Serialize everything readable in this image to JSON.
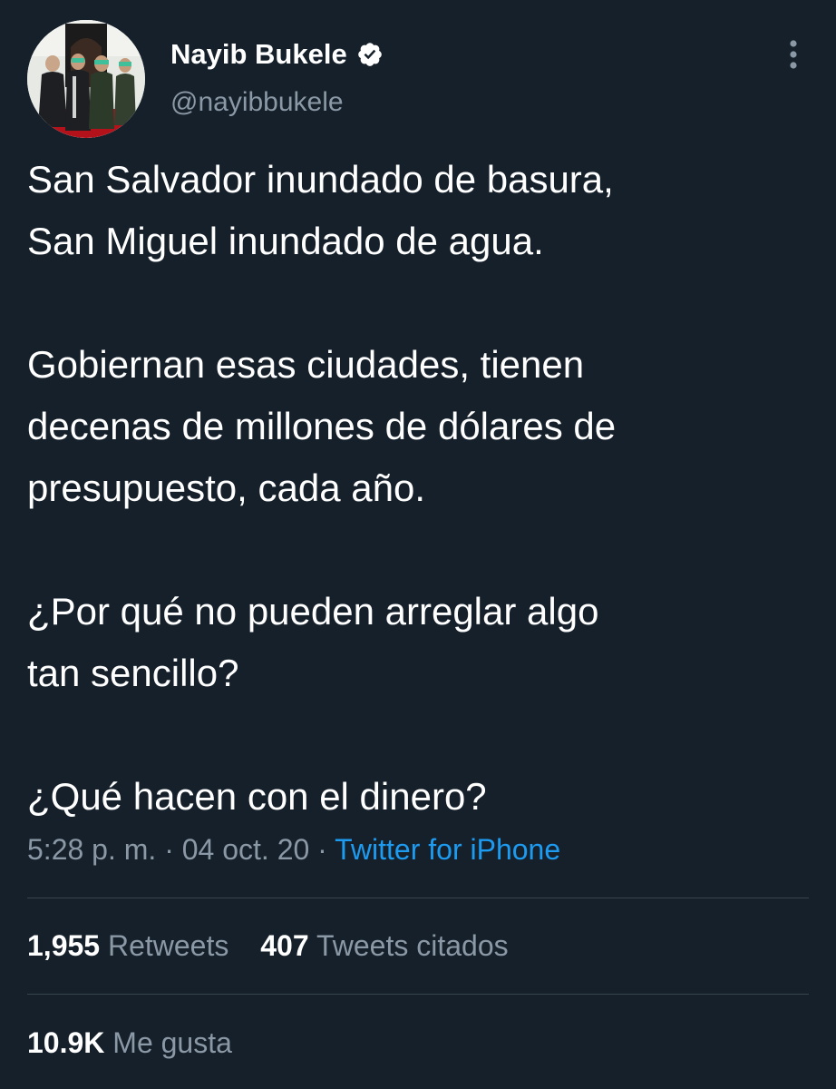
{
  "author": {
    "name": "Nayib Bukele",
    "handle": "@nayibbukele",
    "verified": true,
    "avatar_icon": "profile-photo"
  },
  "tweet": {
    "paragraphs": [
      [
        "San Salvador inundado de basura,",
        "San Miguel inundado de agua."
      ],
      [
        "Gobiernan esas ciudades, tienen",
        "decenas de millones de dólares de",
        "presupuesto, cada año."
      ],
      [
        "¿Por qué no pueden arreglar algo",
        "tan sencillo?"
      ],
      [
        "¿Qué hacen con el dinero?"
      ]
    ],
    "time": "5:28 p. m.",
    "date": "04 oct. 20",
    "source": "Twitter for iPhone",
    "separator": "·"
  },
  "stats": {
    "retweets_count": "1,955",
    "retweets_label": "Retweets",
    "quotes_count": "407",
    "quotes_label": "Tweets citados",
    "likes_count": "10.9K",
    "likes_label": "Me gusta"
  },
  "colors": {
    "background": "#15202b",
    "text": "#ffffff",
    "secondary": "#8b98a5",
    "link": "#1d9bf0",
    "divider": "#38444d"
  }
}
